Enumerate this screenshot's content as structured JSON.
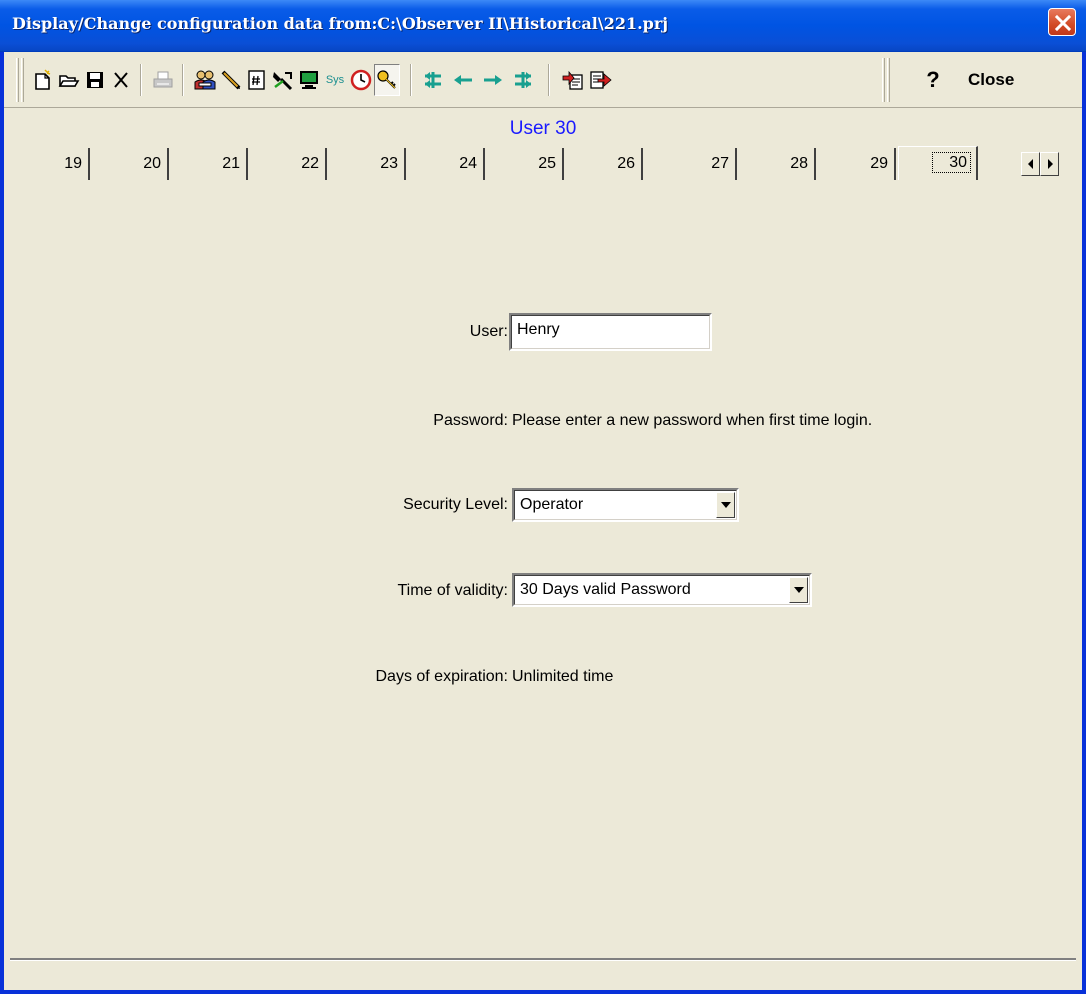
{
  "window": {
    "title": "Display/Change configuration data from:C:\\Observer II\\Historical\\221.prj"
  },
  "toolbar": {
    "sys_label": "Sys",
    "help_label": "?",
    "close_label": "Close",
    "icons": [
      "new-file-icon",
      "open-folder-icon",
      "save-disk-icon",
      "delete-x-icon",
      "print-icon",
      "users-icon",
      "pencil-icon",
      "numbered-page-icon",
      "tools-icon",
      "monitor-icon",
      "sys-icon",
      "clock-icon",
      "key-icon",
      "first-record-icon",
      "previous-record-icon",
      "next-record-icon",
      "last-record-icon",
      "copy-icon",
      "export-icon"
    ]
  },
  "header": {
    "title": "User 30"
  },
  "tabs": [
    "19",
    "20",
    "21",
    "22",
    "23",
    "24",
    "25",
    "26",
    "27",
    "28",
    "29",
    "30"
  ],
  "active_tab": "30",
  "form": {
    "user_label": "User:",
    "user_value": "Henry",
    "password_label": "Password:",
    "password_text": "Please enter a new password when first time login.",
    "security_label": "Security Level:",
    "security_value": "Operator",
    "validity_label": "Time of validity:",
    "validity_value": "30 Days valid Password",
    "expiration_label": "Days of expiration:",
    "expiration_value": "Unlimited time"
  },
  "colors": {
    "title_blue": "#0054e3",
    "header_text": "#1a1aff",
    "face": "#ece9d8"
  }
}
